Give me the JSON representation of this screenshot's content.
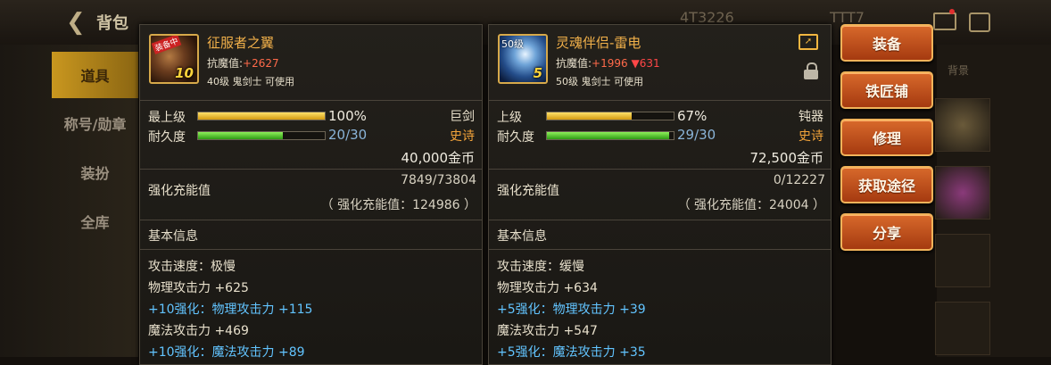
{
  "background": {
    "bag_title": "背包",
    "header_right": "4T3226",
    "header_right2": "TTT7",
    "sidebar": [
      "道具",
      "称号/勋章",
      "装扮",
      "全库"
    ],
    "right_tab": "背景"
  },
  "left_item": {
    "level_tag": "",
    "badge": "装备中",
    "icon_level": "10",
    "name": "征服者之翼",
    "stat_label": "抗魔值:",
    "stat_value": "+2627",
    "requirement": "40级 鬼剑士 可使用",
    "max_level_label": "最上级",
    "max_level_pct": "100%",
    "max_level_fill": 1.0,
    "type": "巨剑",
    "durability_label": "耐久度",
    "durability": "20/30",
    "durability_fill": 0.667,
    "rarity": "史诗",
    "price": "40,000金币",
    "enhance_label": "强化充能值",
    "enhance_value": "7849/73804",
    "enhance_sub": "（ 强化充能值：124986 ）",
    "basic_info": "基本信息",
    "attrs": [
      {
        "text": "攻击速度：极慢",
        "blue": false
      },
      {
        "text": "物理攻击力 +625",
        "blue": false
      },
      {
        "text": "+10强化：物理攻击力 +115",
        "blue": true
      },
      {
        "text": "魔法攻击力 +469",
        "blue": false
      },
      {
        "text": "+10强化：魔法攻击力 +89",
        "blue": true
      }
    ]
  },
  "right_item": {
    "level_tag": "50级",
    "icon_level": "5",
    "name": "灵魂伴侣-雷电",
    "stat_label": "抗魔值:",
    "stat_value": "+1996",
    "stat_diff": "▼631",
    "requirement": "50级 鬼剑士 可使用",
    "max_level_label": "上级",
    "max_level_pct": "67%",
    "max_level_fill": 0.67,
    "type": "钝器",
    "durability_label": "耐久度",
    "durability": "29/30",
    "durability_fill": 0.967,
    "rarity": "史诗",
    "price": "72,500金币",
    "enhance_label": "强化充能值",
    "enhance_value": "0/12227",
    "enhance_sub": "（ 强化充能值：24004 ）",
    "basic_info": "基本信息",
    "attrs": [
      {
        "text": "攻击速度：缓慢",
        "blue": false
      },
      {
        "text": "物理攻击力 +634",
        "blue": false
      },
      {
        "text": "+5强化：物理攻击力 +39",
        "blue": true
      },
      {
        "text": "魔法攻击力 +547",
        "blue": false
      },
      {
        "text": "+5强化：魔法攻击力 +35",
        "blue": true
      }
    ]
  },
  "actions": [
    "装备",
    "铁匠铺",
    "修理",
    "获取途径",
    "分享"
  ],
  "colors": {
    "gold": "#f2b14a",
    "blue_text": "#62c4ff",
    "button": "#c2501c"
  }
}
